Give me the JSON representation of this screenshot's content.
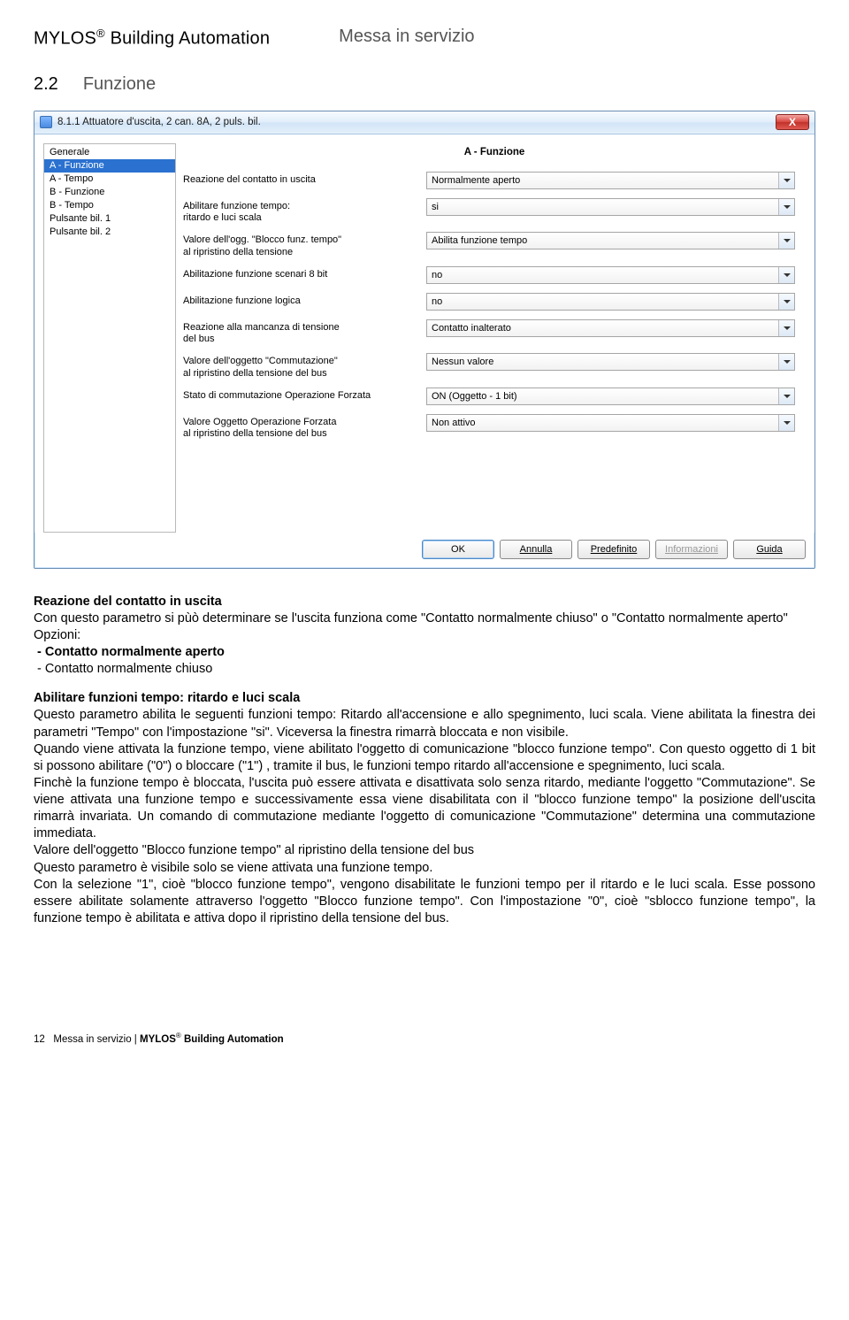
{
  "header": {
    "brand": "MYLOS",
    "brand_suffix": " Building Automation",
    "register": "®",
    "section_title": "Messa in servizio"
  },
  "section": {
    "number": "2.2",
    "name": "Funzione"
  },
  "dialog": {
    "window_title": "8.1.1 Attuatore d'uscita, 2 can. 8A, 2 puls. bil.",
    "close": "X",
    "sidebar": [
      "Generale",
      "A - Funzione",
      "A - Tempo",
      "B - Funzione",
      "B - Tempo",
      "Pulsante bil. 1",
      "Pulsante bil. 2"
    ],
    "selected_index": 1,
    "panel_title": "A - Funzione",
    "rows": [
      {
        "label": "Reazione del contatto in uscita",
        "value": "Normalmente aperto"
      },
      {
        "label": "Abilitare funzione tempo:\nritardo e luci scala",
        "value": "si"
      },
      {
        "label": "Valore dell'ogg. \"Blocco funz. tempo\"\nal ripristino della tensione",
        "value": "Abilita funzione tempo"
      },
      {
        "label": "Abilitazione funzione scenari 8 bit",
        "value": "no"
      },
      {
        "label": "Abilitazione funzione logica",
        "value": "no"
      },
      {
        "label": "Reazione alla mancanza di tensione\ndel bus",
        "value": "Contatto inalterato"
      },
      {
        "label": "Valore dell'oggetto \"Commutazione\"\nal ripristino della tensione del bus",
        "value": "Nessun valore"
      },
      {
        "label": "Stato di commutazione Operazione Forzata",
        "value": "ON (Oggetto - 1 bit)"
      },
      {
        "label": "Valore Oggetto Operazione Forzata\nal ripristino della tensione del bus",
        "value": "Non attivo"
      }
    ],
    "buttons": {
      "ok": "OK",
      "cancel": "Annulla",
      "default": "Predefinito",
      "info": "Informazioni",
      "help": "Guida"
    }
  },
  "body": {
    "h1": "Reazione del contatto in uscita",
    "p1": "Con questo parametro si pùò determinare se l'uscita funziona come \"Contatto normalmente chiuso\" o \"Contatto normalmente aperto\"",
    "opts_label": "Opzioni:",
    "opt1": "Contatto normalmente aperto",
    "opt2": "Contatto normalmente chiuso",
    "h2": "Abilitare funzioni tempo: ritardo e luci scala",
    "p2": "Questo parametro abilita le seguenti funzioni tempo: Ritardo all'accensione e allo spegnimento, luci scala. Viene abilitata la finestra dei parametri \"Tempo\" con l'impostazione \"si\". Viceversa la finestra rimarrà bloccata e non visibile.",
    "p3": "Quando viene attivata la funzione tempo, viene abilitato l'oggetto di comunicazione \"blocco funzione tempo\". Con questo oggetto di 1 bit si possono abilitare (\"0\") o bloccare (\"1\") , tramite il bus, le funzioni tempo ritardo all'accensione e spegnimento, luci scala.",
    "p4": "Finchè la funzione tempo è bloccata, l'uscita può essere attivata e disattivata solo senza ritardo, mediante l'oggetto \"Commutazione\". Se viene attivata una funzione tempo e successivamente essa viene disabilitata con il \"blocco funzione tempo\" la posizione dell'uscita rimarrà invariata. Un comando di commutazione mediante l'oggetto di comunicazione \"Commutazione\" determina una commutazione immediata.",
    "p5": "Valore dell'oggetto \"Blocco funzione tempo\" al ripristino della tensione del bus",
    "p6": "Questo parametro è visibile solo se viene attivata una funzione tempo.",
    "p7": "Con la selezione \"1\", cioè \"blocco funzione tempo\", vengono disabilitate le funzioni tempo per il ritardo e le luci scala. Esse possono essere abilitate solamente attraverso l'oggetto \"Blocco funzione tempo\". Con l'impostazione \"0\", cioè \"sblocco funzione tempo\", la funzione tempo è abilitata e attiva dopo il ripristino della tensione del bus."
  },
  "footer": {
    "page": "12",
    "text1": "Messa in servizio",
    "sep": " | ",
    "text2": "MYLOS",
    "reg": "®",
    "text3": " Building Automation"
  }
}
